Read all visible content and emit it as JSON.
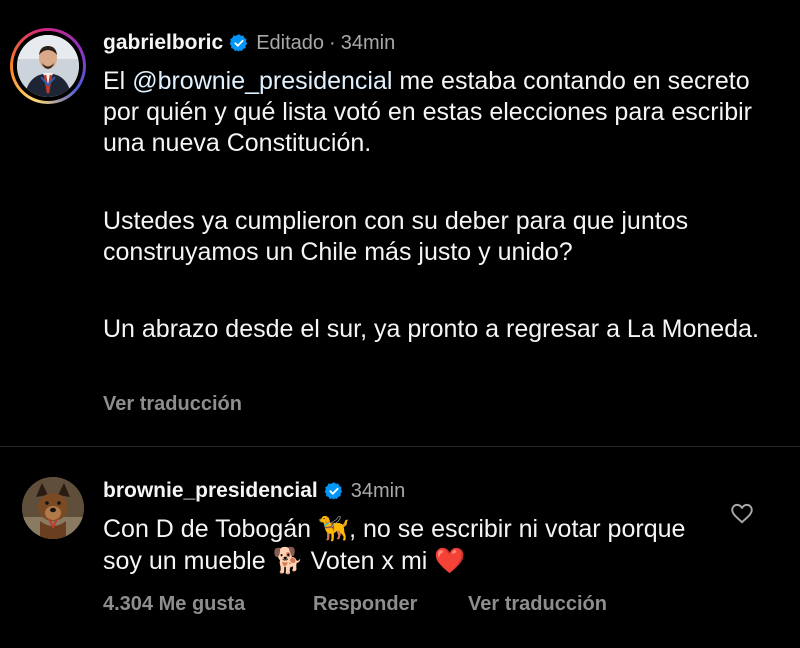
{
  "post": {
    "username": "gabrielboric",
    "edited_label": "Editado",
    "separator": "·",
    "time": "34min",
    "text_intro": "El ",
    "mention": "@brownie_presidencial",
    "text_rest": " me estaba contando en secreto por quién y qué lista votó en estas elecciones para escribir una nueva Constitución.",
    "paragraph2": "Ustedes ya cumplieron con su deber para que juntos construyamos un Chile más justo y unido?",
    "paragraph3": "Un abrazo desde el sur, ya pronto a regresar a La Moneda.",
    "translate_label": "Ver traducción"
  },
  "reply": {
    "username": "brownie_presidencial",
    "time": "34min",
    "text_part1": "Con D de Tobogán ",
    "dog_emoji_1": "🦮",
    "text_part2": ", no se escribir ni votar porque soy un mueble ",
    "dog_emoji_2": "🐕",
    "text_part3": " Voten x mi ",
    "heart_emoji": "❤️",
    "likes_label": "4.304 Me gusta",
    "reply_label": "Responder",
    "translate_label": "Ver traducción"
  },
  "colors": {
    "background": "#000000",
    "primary_text": "#f5f5f5",
    "secondary_text": "#a8a8a8",
    "verified_blue": "#0095f6",
    "heart_red": "#e0245e"
  },
  "icons": [
    "verified-badge-icon",
    "like-heart-icon"
  ]
}
